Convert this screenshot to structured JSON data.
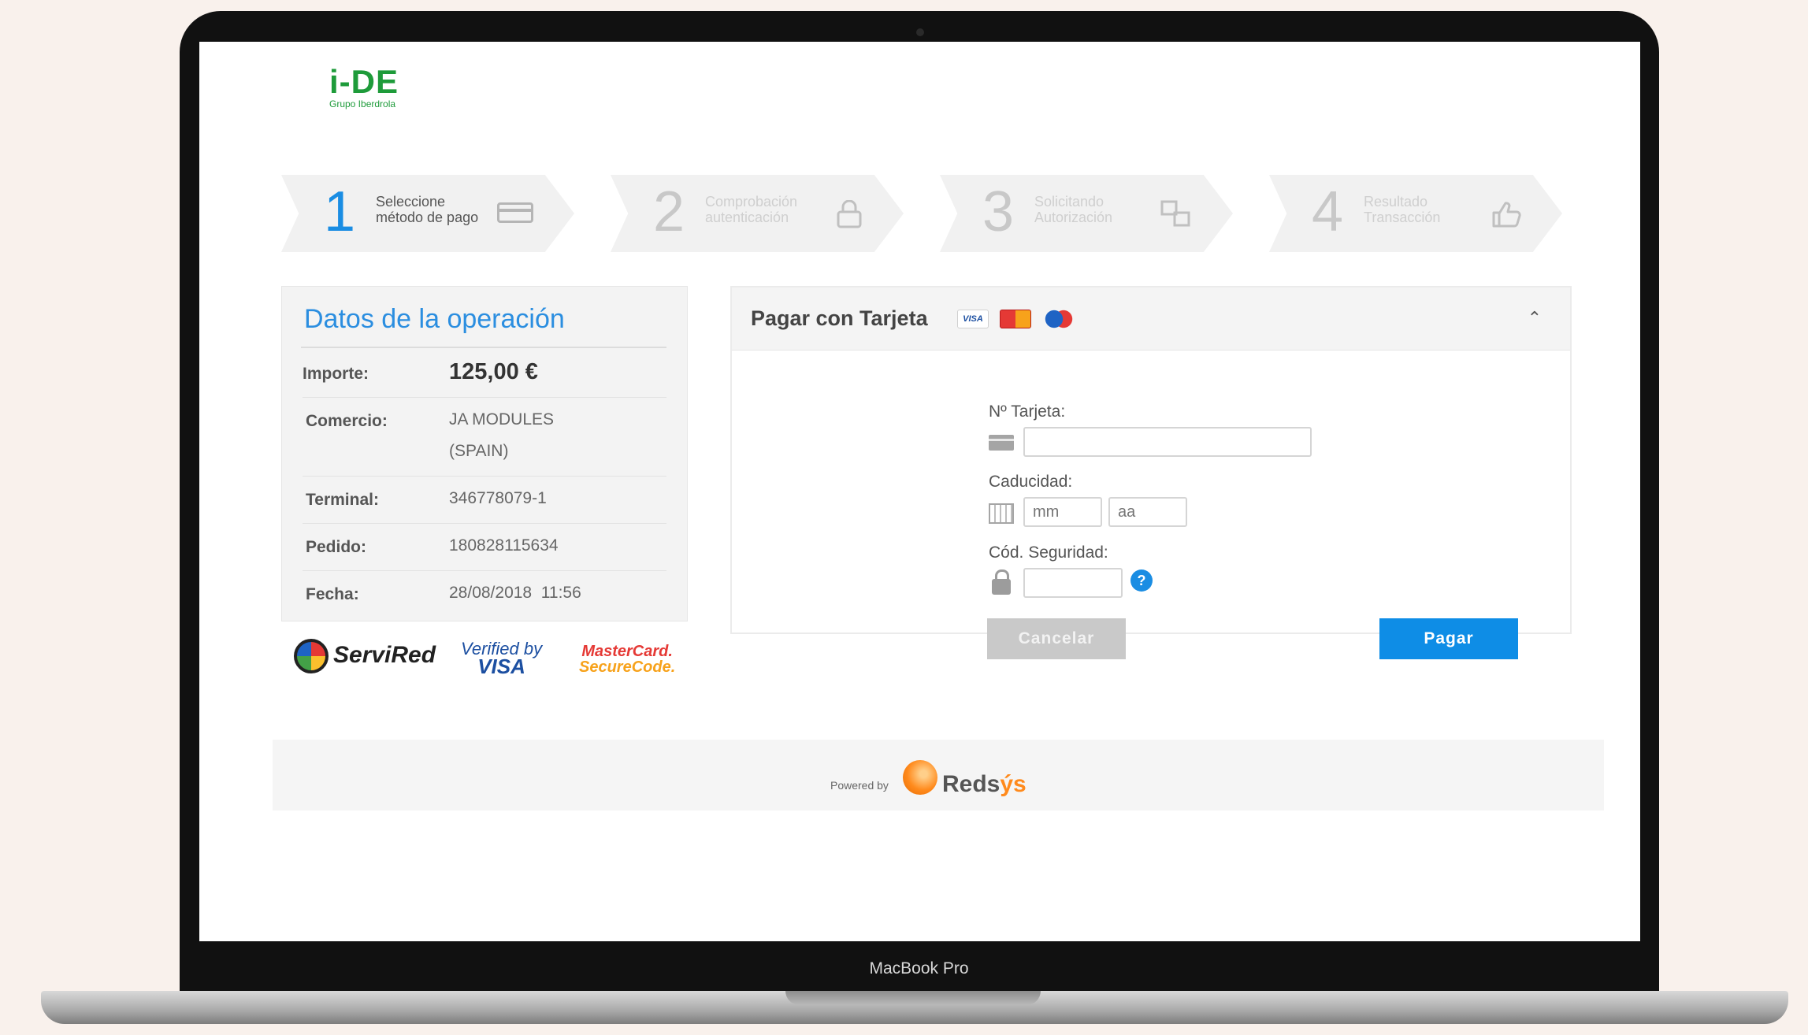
{
  "device": {
    "label": "MacBook Pro"
  },
  "logo": {
    "main": "i-DE",
    "sub": "Grupo Iberdrola"
  },
  "steps": [
    {
      "num": "1",
      "line1": "Seleccione",
      "line2": "método de pago",
      "icon": "credit-card-icon",
      "active": true
    },
    {
      "num": "2",
      "line1": "Comprobación",
      "line2": "autenticación",
      "icon": "lock-icon",
      "active": false
    },
    {
      "num": "3",
      "line1": "Solicitando",
      "line2": "Autorización",
      "icon": "transfer-icon",
      "active": false
    },
    {
      "num": "4",
      "line1": "Resultado",
      "line2": "Transacción",
      "icon": "thumbs-up-icon",
      "active": false
    }
  ],
  "operation": {
    "title": "Datos de la operación",
    "rows": [
      {
        "label": "Importe:",
        "value": "125,00 €"
      },
      {
        "label": "Comercio:",
        "value": "JA MODULES",
        "value2": "(SPAIN)"
      },
      {
        "label": "Terminal:",
        "value": "346778079-1"
      },
      {
        "label": "Pedido:",
        "value": "180828115634"
      },
      {
        "label": "Fecha:",
        "value": "28/08/2018  11:56"
      }
    ]
  },
  "brands": {
    "servired": "ServiRed",
    "verified_line1": "Verified by",
    "verified_line2": "VISA",
    "mc_line1": "MasterCard.",
    "mc_line2": "SecureCode."
  },
  "payment": {
    "title": "Pagar con Tarjeta",
    "mini_visa": "VISA",
    "card_label": "Nº Tarjeta:",
    "card_value": "",
    "expiry_label": "Caducidad:",
    "month_placeholder": "mm",
    "year_placeholder": "aa",
    "cvv_label": "Cód. Seguridad:",
    "cvv_value": "",
    "help": "?",
    "cancel": "Cancelar",
    "pay": "Pagar"
  },
  "footer": {
    "powered_by": "Powered by",
    "brand_a": "Reds",
    "brand_b": "ýs"
  },
  "colors": {
    "accent": "#1a8de3",
    "brand_green": "#1e9b3a",
    "redsys_orange": "#ff8a1c"
  }
}
